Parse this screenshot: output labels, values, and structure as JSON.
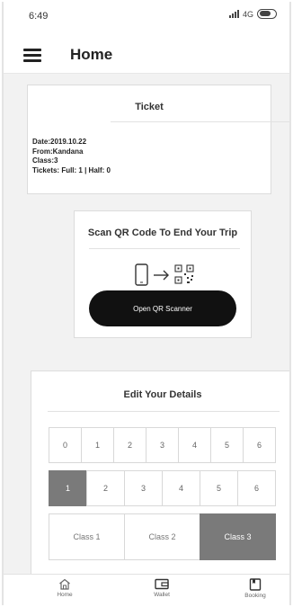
{
  "status_bar": {
    "time": "6:49",
    "network": "4G"
  },
  "app_bar": {
    "title": "Home"
  },
  "ticket": {
    "title": "Ticket",
    "lines": [
      "Date:2019.10.22",
      "From:Kandana",
      "Class:3",
      "Tickets: Full: 1 | Half: 0"
    ]
  },
  "qr": {
    "title": "Scan QR Code To End Your Trip",
    "button_label": "Open QR Scanner"
  },
  "details": {
    "title": "Edit Your Details",
    "row1": [
      "0",
      "1",
      "2",
      "3",
      "4",
      "5",
      "6"
    ],
    "row2": [
      "1",
      "2",
      "3",
      "4",
      "5",
      "6"
    ],
    "row2_selected": "1",
    "classes": [
      "Class 1",
      "Class 2",
      "Class 3"
    ],
    "class_selected": "Class 3"
  },
  "nav": [
    {
      "label": "Home",
      "icon": "home-icon"
    },
    {
      "label": "Wallet",
      "icon": "wallet-icon"
    },
    {
      "label": "Booking",
      "icon": "booking-icon"
    }
  ]
}
